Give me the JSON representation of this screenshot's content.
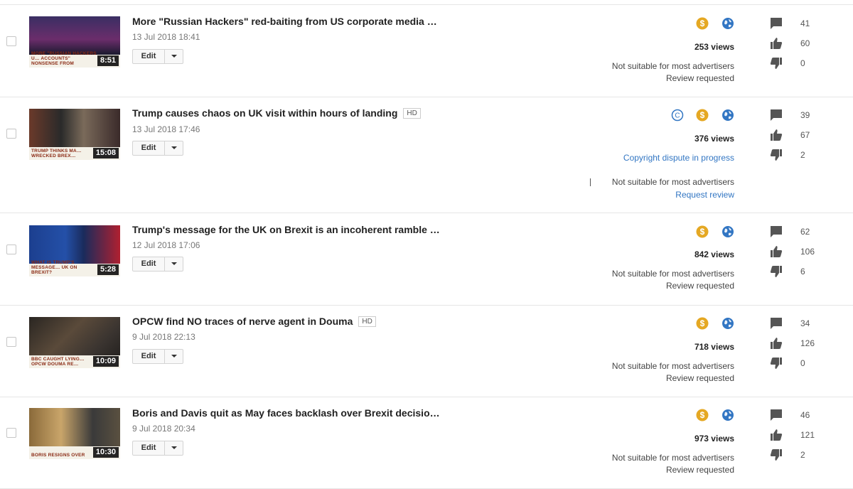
{
  "videos": [
    {
      "title": "More \"Russian Hackers\" red-baiting from US corporate media …",
      "hd": "",
      "date": "13 Jul 2018 18:41",
      "duration": "8:51",
      "caption": "More \"Russian Hackers u… Accounts\" Nonsense from",
      "edit": "Edit",
      "views": "253 views",
      "status1": "Not suitable for most advertisers",
      "status2": "Review requested",
      "comments": "41",
      "likes": "60",
      "dislikes": "0"
    },
    {
      "title": "Trump causes chaos on UK visit within hours of landing",
      "hd": "HD",
      "date": "13 Jul 2018 17:46",
      "duration": "15:08",
      "caption": "Trump thinks Ma… wrecked Brex…",
      "edit": "Edit",
      "views": "376 views",
      "copyright": "Copyright dispute in progress",
      "status1": "Not suitable for most advertisers",
      "status2": "Request review",
      "comments": "39",
      "likes": "67",
      "dislikes": "2"
    },
    {
      "title": "Trump's message for the UK on Brexit is an incoherent ramble …",
      "hd": "",
      "date": "12 Jul 2018 17:06",
      "duration": "5:28",
      "caption": "What is Trump's message… UK on Brexit?",
      "edit": "Edit",
      "views": "842 views",
      "status1": "Not suitable for most advertisers",
      "status2": "Review requested",
      "comments": "62",
      "likes": "106",
      "dislikes": "6"
    },
    {
      "title": "OPCW find NO traces of nerve agent in Douma",
      "hd": "HD",
      "date": "9 Jul 2018 22:13",
      "duration": "10:09",
      "caption": "BBC caught lying… OPCW Douma re…",
      "edit": "Edit",
      "views": "718 views",
      "status1": "Not suitable for most advertisers",
      "status2": "Review requested",
      "comments": "34",
      "likes": "126",
      "dislikes": "0"
    },
    {
      "title": "Boris and Davis quit as May faces backlash over Brexit decisio…",
      "hd": "",
      "date": "9 Jul 2018 20:34",
      "duration": "10:30",
      "caption": "Boris resigns over",
      "edit": "Edit",
      "views": "973 views",
      "status1": "Not suitable for most advertisers",
      "status2": "Review requested",
      "comments": "46",
      "likes": "121",
      "dislikes": "2"
    }
  ],
  "icons": {
    "monetization": "dollar-coin-icon",
    "visibility": "globe-icon",
    "copyright": "copyright-icon",
    "comments": "comment-icon",
    "likes": "thumbs-up-icon",
    "dislikes": "thumbs-down-icon"
  },
  "colors": {
    "monetization": "#e5a823",
    "visibility": "#3276c3",
    "link": "#3276c3",
    "stat_icon": "#555555"
  }
}
